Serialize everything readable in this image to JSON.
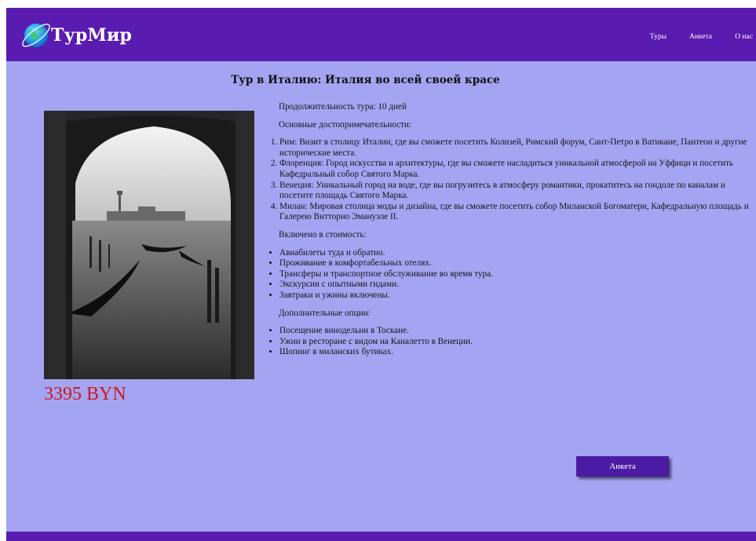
{
  "header": {
    "brand": "ТурМир",
    "nav": [
      {
        "label": "Туры"
      },
      {
        "label": "Анкета"
      },
      {
        "label": "О нас"
      }
    ]
  },
  "tour": {
    "title": "Тур в Италию: Италия во всей своей красе",
    "price": "3395 BYN",
    "duration": "Продолжительность тура: 10 дней",
    "attractions_heading": "Основные достопримечательности:",
    "attractions": [
      "Рим: Визит в столицу Италии, где вы сможете посетить Колизей, Римский форум, Сант-Петро в Ватикане, Пантеон и другие исторические места.",
      "Флоренция: Город искусства и архитектуры, где вы сможете насладиться уникальной атмосферой на Уффици и посетить Кафедральный собор Святого Марка.",
      "Венеция: Уникальный город на воде, где вы погрузитесь в атмосферу романтики, прокатитесь на гондоле по каналам и посетите площадь Святого Марка.",
      "Милан: Мировая столица моды и дизайна, где вы сможете посетить собор Миланской Богоматери, Кафедральную площадь и Галерею Витторио Эмануэле II."
    ],
    "included_heading": "Включено в стоимость:",
    "included": [
      "Авиабилеты туда и обратно.",
      "Проживание в комфортабельных отелях.",
      "Трансферы и транспортное обслуживание во время тура.",
      "Экскурсии с опытными гидами.",
      "Завтраки и ужины включены."
    ],
    "options_heading": "Дополнительные опции:",
    "options": [
      "Посещение винодельни в Тоскане.",
      "Ужин в ресторане с видом на Каналетто в Венеции.",
      "Шопинг в миланских бутиках."
    ],
    "form_button": "Анкета"
  },
  "colors": {
    "header_bg": "#5a1bb0",
    "page_bg": "#a4a4f2",
    "price": "#cc1717",
    "button_bg": "#4b1ba3"
  },
  "icons": [
    "globe-logo-icon"
  ]
}
